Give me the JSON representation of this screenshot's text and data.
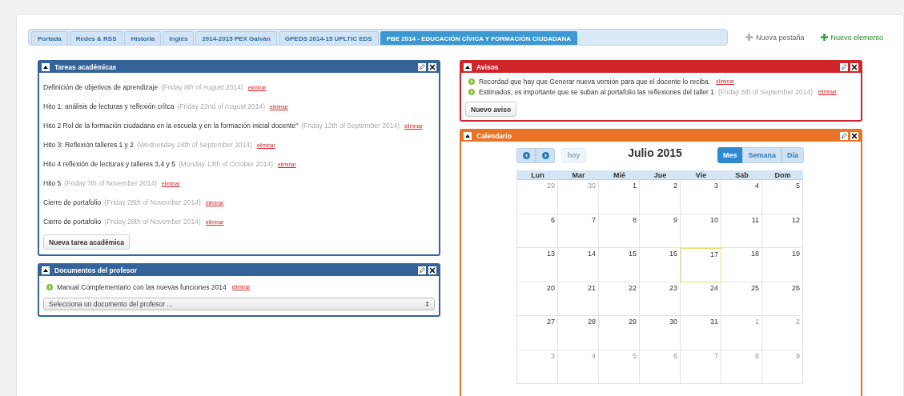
{
  "tabs": [
    {
      "label": "Portada",
      "selected": false
    },
    {
      "label": "Redes & RSS",
      "selected": false
    },
    {
      "label": "Historia",
      "selected": false
    },
    {
      "label": "Inglés",
      "selected": false
    },
    {
      "label": "2014-2015 PEX Galván",
      "selected": false
    },
    {
      "label": "GPEDS 2014-15 UPLTIC EDS",
      "selected": false
    },
    {
      "label": "PBE 2014 - EDUCACIÓN CÍVICA Y FORMACIÓN CIUDADANA",
      "selected": true
    }
  ],
  "actions": [
    {
      "label": "Nueva pestaña",
      "kind": "neutral"
    },
    {
      "label": "Nuevo elemento",
      "kind": "add"
    }
  ],
  "tareas": {
    "title": "Tareas académicas",
    "color": "#34639a",
    "items": [
      {
        "text": "Definición de objetivos de aprendizaje",
        "date": "(Friday 8th of August 2014)",
        "action": "eliminar"
      },
      {
        "text": "Hito 1: análisis de lecturas y reflexión crítca",
        "date": "(Friday 22nd of August 2014)",
        "action": "eliminar"
      },
      {
        "text": "Hito 2 Rol de la formación ciudadana en la escuela y en la formación inicial docente\"",
        "date": "(Friday 12th of September 2014)",
        "action": "eliminar"
      },
      {
        "text": "Hito 3: Reflexión talleres 1 y 2",
        "date": "(Wednesday 24th of September 2014)",
        "action": "eliminar"
      },
      {
        "text": "Hito 4 reflexión de lecturas y talleres 3,4 y 5",
        "date": "(Monday 13th of October 2014)",
        "action": "eliminar"
      },
      {
        "text": "Hito 5",
        "date": "(Friday 7th of November 2014)",
        "action": "eliminar"
      },
      {
        "text": "Cierre de portafolio",
        "date": "(Friday 28th of November 2014)",
        "action": "eliminar"
      },
      {
        "text": "Cierre de portafolio",
        "date": "(Friday 28th of November 2014)",
        "action": "eliminar"
      }
    ],
    "button": "Nueva tarea académica"
  },
  "documentos": {
    "title": "Documentos del profesor",
    "color": "#34639a",
    "items": [
      {
        "text": "Manual Complementario con las nuevas funciones 2014",
        "action": "eliminar"
      }
    ],
    "select": {
      "value": "Selecciona un documento del profesor ..."
    }
  },
  "avisos": {
    "title": "Avisos",
    "color": "#d0232a",
    "items": [
      {
        "text": "Recordad que hay que Generar nueva versión para que el docente lo reciba.",
        "action": "eliminar"
      },
      {
        "text": "Estimados, es importante que se suban al portafolio las reflexiones del taller 1",
        "date": "(Friday 5th of September 2014)",
        "action": "eliminar"
      }
    ],
    "button": "Nuevo aviso"
  },
  "calendario": {
    "title": "Calendario",
    "color": "#ea7325",
    "today_button": {
      "label": "hoy",
      "disabled": true
    },
    "month": "Julio 2015",
    "views": [
      {
        "label": "Mes",
        "selected": true
      },
      {
        "label": "Semana",
        "selected": false
      },
      {
        "label": "Día",
        "selected": false
      }
    ],
    "weekdays": [
      "Lun",
      "Mar",
      "Mié",
      "Jue",
      "Vie",
      "Sab",
      "Dom"
    ],
    "weeks": [
      [
        {
          "day": "29",
          "other_month": true,
          "today": false
        },
        {
          "day": "30",
          "other_month": true,
          "today": false
        },
        {
          "day": "1",
          "other_month": false,
          "today": false
        },
        {
          "day": "2",
          "other_month": false,
          "today": false
        },
        {
          "day": "3",
          "other_month": false,
          "today": false
        },
        {
          "day": "4",
          "other_month": false,
          "today": false
        },
        {
          "day": "5",
          "other_month": false,
          "today": false
        }
      ],
      [
        {
          "day": "6",
          "other_month": false,
          "today": false
        },
        {
          "day": "7",
          "other_month": false,
          "today": false
        },
        {
          "day": "8",
          "other_month": false,
          "today": false
        },
        {
          "day": "9",
          "other_month": false,
          "today": false
        },
        {
          "day": "10",
          "other_month": false,
          "today": false
        },
        {
          "day": "11",
          "other_month": false,
          "today": false
        },
        {
          "day": "12",
          "other_month": false,
          "today": false
        }
      ],
      [
        {
          "day": "13",
          "other_month": false,
          "today": false
        },
        {
          "day": "14",
          "other_month": false,
          "today": false
        },
        {
          "day": "15",
          "other_month": false,
          "today": false
        },
        {
          "day": "16",
          "other_month": false,
          "today": false
        },
        {
          "day": "17",
          "other_month": false,
          "today": true
        },
        {
          "day": "18",
          "other_month": false,
          "today": false
        },
        {
          "day": "19",
          "other_month": false,
          "today": false
        }
      ],
      [
        {
          "day": "20",
          "other_month": false,
          "today": false
        },
        {
          "day": "21",
          "other_month": false,
          "today": false
        },
        {
          "day": "22",
          "other_month": false,
          "today": false
        },
        {
          "day": "23",
          "other_month": false,
          "today": false
        },
        {
          "day": "24",
          "other_month": false,
          "today": false
        },
        {
          "day": "25",
          "other_month": false,
          "today": false
        },
        {
          "day": "26",
          "other_month": false,
          "today": false
        }
      ],
      [
        {
          "day": "27",
          "other_month": false,
          "today": false
        },
        {
          "day": "28",
          "other_month": false,
          "today": false
        },
        {
          "day": "29",
          "other_month": false,
          "today": false
        },
        {
          "day": "30",
          "other_month": false,
          "today": false
        },
        {
          "day": "31",
          "other_month": false,
          "today": false
        },
        {
          "day": "1",
          "other_month": true,
          "today": false
        },
        {
          "day": "2",
          "other_month": true,
          "today": false
        }
      ],
      [
        {
          "day": "3",
          "other_month": true,
          "today": false
        },
        {
          "day": "4",
          "other_month": true,
          "today": false
        },
        {
          "day": "5",
          "other_month": true,
          "today": false
        },
        {
          "day": "6",
          "other_month": true,
          "today": false
        },
        {
          "day": "7",
          "other_month": true,
          "today": false
        },
        {
          "day": "8",
          "other_month": true,
          "today": false
        },
        {
          "day": "9",
          "other_month": true,
          "today": false
        }
      ]
    ]
  }
}
